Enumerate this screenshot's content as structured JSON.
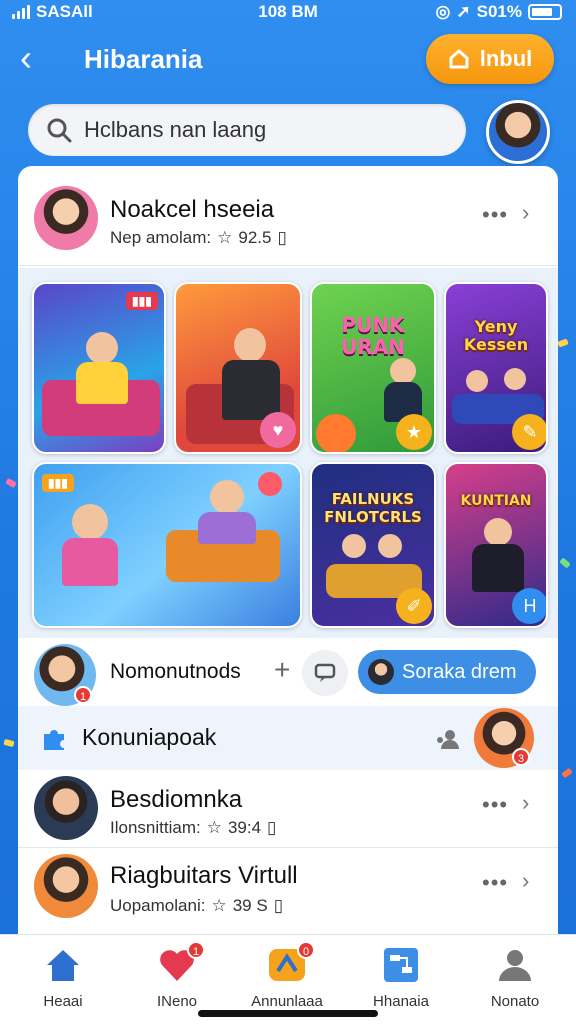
{
  "status_bar": {
    "carrier": "SASAll",
    "time": "108 BM",
    "battery": "S01%"
  },
  "header": {
    "title": "Hibarania",
    "action_label": "lnbul"
  },
  "search": {
    "placeholder": "Hclbans nan laang"
  },
  "profile": {
    "name": "Noakcel hseeia",
    "subtitle": "Nep amolam:",
    "stat": "92.5"
  },
  "tiles": [
    {
      "tag": ""
    },
    {
      "tag": ""
    },
    {
      "title": "PUNK URAN",
      "tag": ""
    },
    {
      "title": "Yeny Kessen",
      "tag": ""
    },
    {
      "tag": ""
    },
    {
      "title": "FAILNUKS FNLOTCRLS",
      "tag": ""
    },
    {
      "title": "KUNTIAN",
      "tag": ""
    }
  ],
  "friends": {
    "label": "Nomonutnods",
    "plus": "+",
    "pill_label": "Soraka drem",
    "badge_count": "1"
  },
  "community": {
    "label": "Konuniapoak",
    "badge_count": "3"
  },
  "list": [
    {
      "name": "Besdiomnka",
      "subtitle": "Ilonsnittiam:",
      "stat": "39:4"
    },
    {
      "name": "Riagbuitars Virtull",
      "subtitle": "Uopamolani:",
      "stat": "39 S"
    }
  ],
  "nav": [
    {
      "label": "Heaai",
      "icon": "home-icon"
    },
    {
      "label": "INeno",
      "icon": "heart-icon",
      "badge": "1"
    },
    {
      "label": "Annunlaaa",
      "icon": "announce-icon",
      "badge": "0"
    },
    {
      "label": "Hhanaia",
      "icon": "board-icon"
    },
    {
      "label": "Nonato",
      "icon": "person-icon"
    }
  ],
  "colors": {
    "accent": "#2f8ef0",
    "orange": "#f5a21d",
    "pill": "#3d8fe6"
  }
}
